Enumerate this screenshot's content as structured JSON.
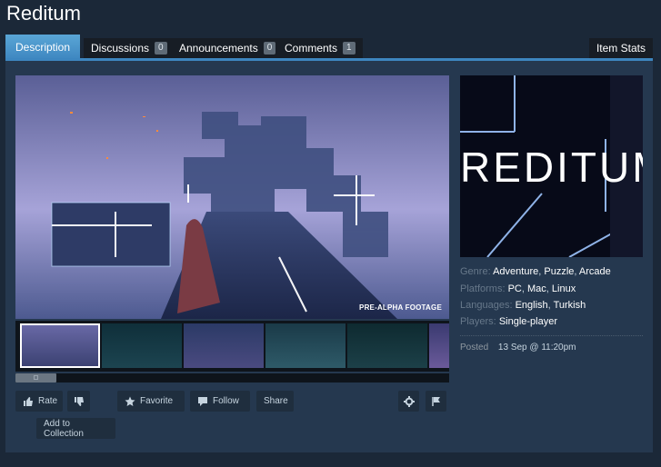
{
  "page": {
    "title": "Reditum"
  },
  "tabs": [
    {
      "label": "Description",
      "count": null,
      "active": true
    },
    {
      "label": "Discussions",
      "count": "0",
      "active": false
    },
    {
      "label": "Announcements",
      "count": "0",
      "active": false
    },
    {
      "label": "Comments",
      "count": "1",
      "active": false
    }
  ],
  "item_stats_label": "Item Stats",
  "media": {
    "main_caption": "PRE-ALPHA FOOTAGE",
    "thumbnails_count_visible": 6
  },
  "actions": {
    "rate": "Rate",
    "favorite": "Favorite",
    "follow": "Follow",
    "share": "Share",
    "add_to_collection": "Add to Collection"
  },
  "capsule": {
    "title": "REDITUM"
  },
  "details": {
    "genre_label": "Genre:",
    "genres": [
      "Adventure",
      "Puzzle",
      "Arcade"
    ],
    "platforms_label": "Platforms:",
    "platforms": [
      "PC",
      "Mac",
      "Linux"
    ],
    "languages_label": "Languages:",
    "languages": [
      "English",
      "Turkish"
    ],
    "players_label": "Players:",
    "players": [
      "Single-player"
    ],
    "posted_label": "Posted",
    "posted_value": "13 Sep @ 11:20pm"
  },
  "colors": {
    "background": "#1b2838",
    "panel": "#25384f",
    "accent_tab": "#3d86c0",
    "button": "#1f2e3e",
    "label_muted": "#67788a"
  },
  "icons": {
    "rate": "thumbs-up-icon",
    "rate_down": "thumbs-down-icon",
    "favorite": "star-icon",
    "follow": "follow-icon",
    "settings": "gear-icon",
    "report": "flag-icon"
  }
}
